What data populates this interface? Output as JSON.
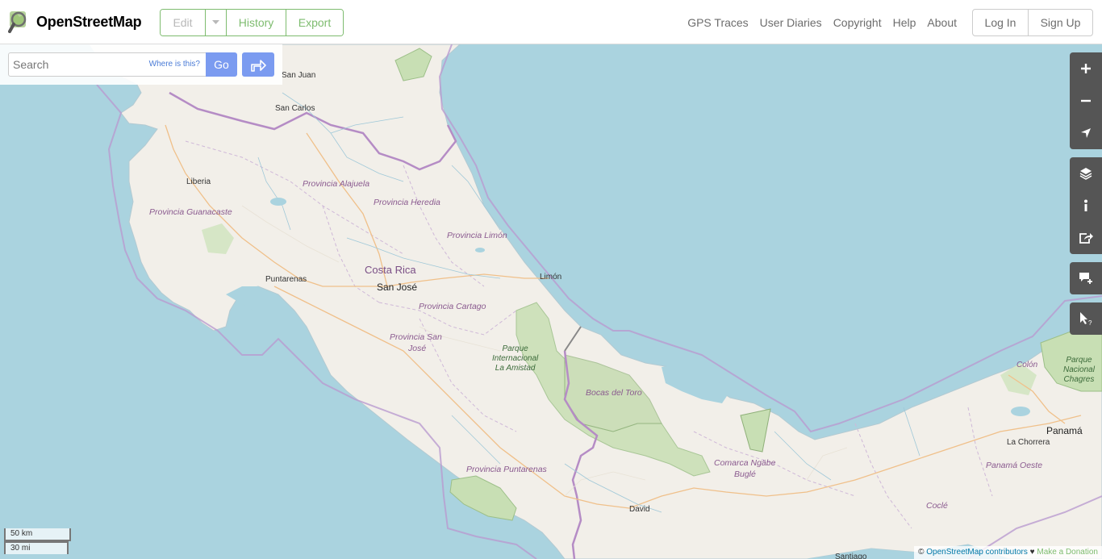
{
  "header": {
    "brand": "OpenStreetMap",
    "edit_label": "Edit",
    "history_label": "History",
    "export_label": "Export",
    "nav": [
      "GPS Traces",
      "User Diaries",
      "Copyright",
      "Help",
      "About"
    ],
    "login_label": "Log In",
    "signup_label": "Sign Up"
  },
  "search": {
    "placeholder": "Search",
    "where_is_this": "Where is this?",
    "go_label": "Go"
  },
  "map": {
    "country_label": "Costa Rica",
    "capital_label": "San José",
    "cities": {
      "san_juan": "San Juan",
      "san_carlos": "San Carlos",
      "liberia": "Liberia",
      "puntarenas": "Puntarenas",
      "limon": "Limón",
      "david": "David",
      "colon": "Colón",
      "panama": "Panamá",
      "la_chorrera": "La Chorrera",
      "santiago": "Santiago",
      "cocle": "Coclé"
    },
    "provinces": {
      "alajuela": "Provincia Alajuela",
      "heredia": "Provincia Heredia",
      "guanacaste": "Provincia Guanacaste",
      "limon": "Provincia Limón",
      "cartago": "Provincia Cartago",
      "san_jose_1": "Provincia San",
      "san_jose_2": "José",
      "puntarenas": "Provincia Puntarenas",
      "bocas": "Bocas del Toro",
      "ngabe_1": "Comarca Ngäbe",
      "ngabe_2": "Buglé",
      "panama_oeste": "Panamá Oeste"
    },
    "parks": {
      "amistad_1": "Parque",
      "amistad_2": "Internacional",
      "amistad_3": "La Amistad",
      "chagres_1": "Parque",
      "chagres_2": "Nacional",
      "chagres_3": "Chagres"
    },
    "colors": {
      "water": "#aad3df",
      "land": "#f2efe9",
      "park": "#c8dfb4",
      "border": "#b99bd0"
    }
  },
  "controls": [
    "zoom-in-icon",
    "zoom-out-icon",
    "locate-icon",
    "layers-icon",
    "info-icon",
    "share-icon",
    "add-note-icon",
    "query-icon"
  ],
  "scale": {
    "km": "50 km",
    "mi": "30 mi"
  },
  "attribution": {
    "prefix": "©",
    "contributors": "OpenStreetMap contributors",
    "heart": "♥",
    "donate": "Make a Donation"
  }
}
